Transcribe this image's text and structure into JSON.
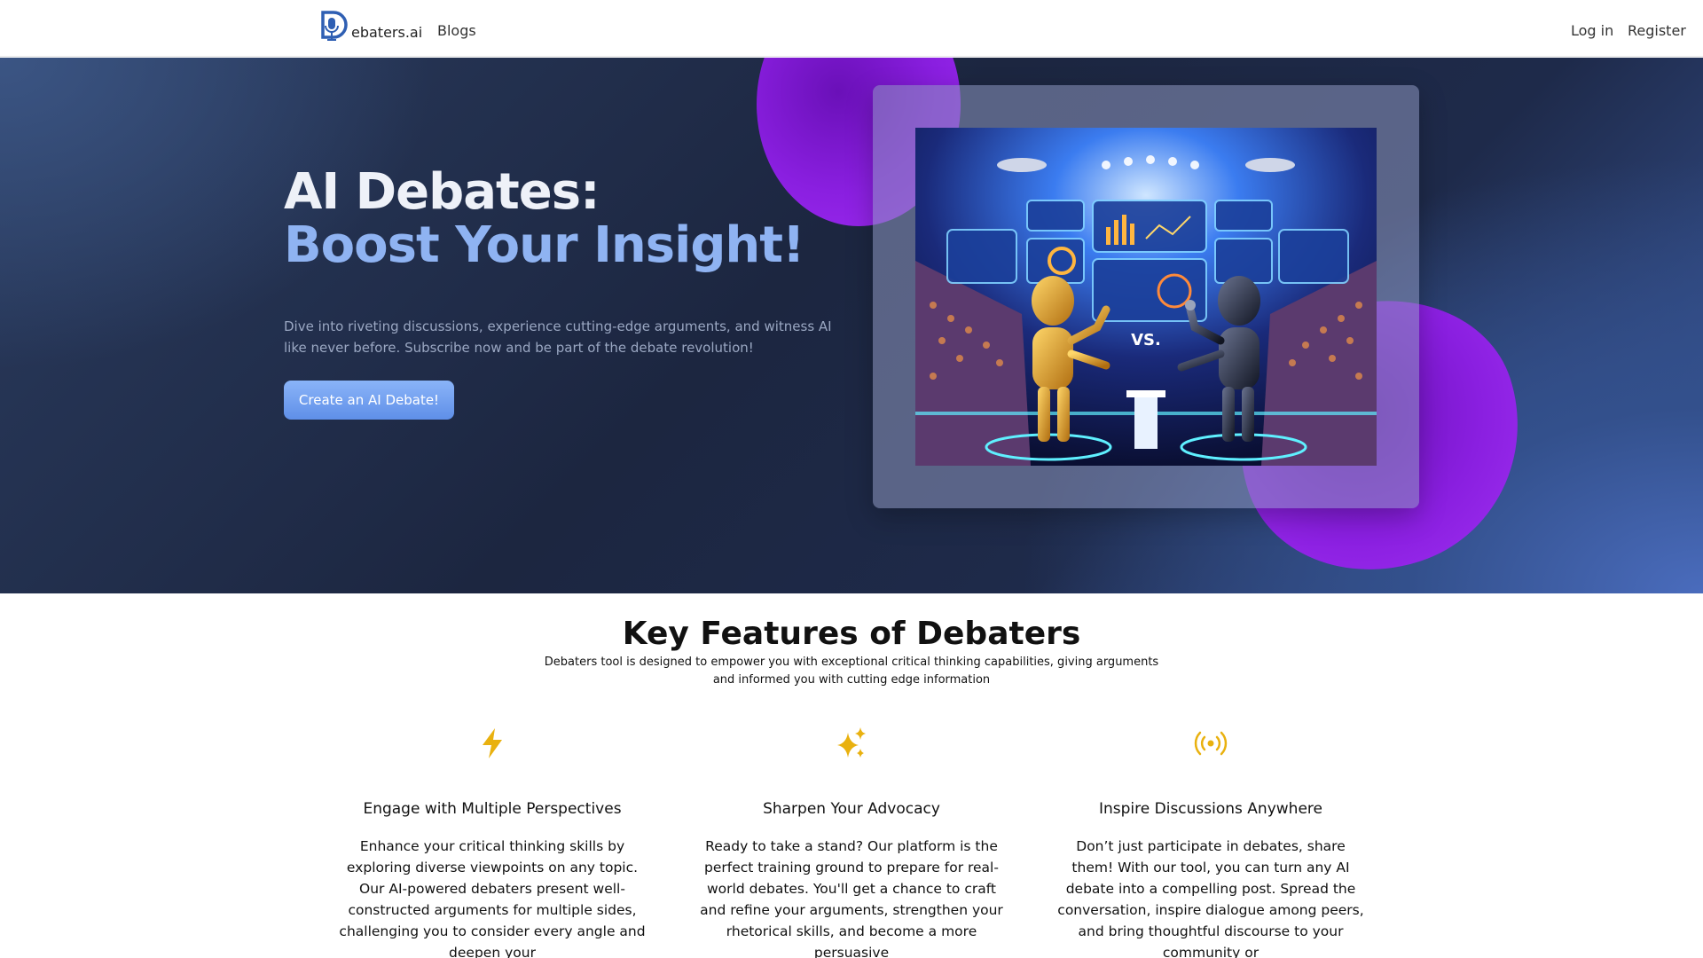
{
  "nav": {
    "logo_text": "ebaters.ai",
    "blogs": "Blogs",
    "login": "Log in",
    "register": "Register"
  },
  "hero": {
    "title_line1": "AI Debates:",
    "title_line2": "Boost Your Insight!",
    "description": "Dive into riveting discussions, experience cutting-edge arguments, and witness AI like never before. Subscribe now and be part of the debate revolution!",
    "cta": "Create an AI Debate!",
    "image_label": "VS."
  },
  "features": {
    "title": "Key Features of Debaters",
    "subtitle": "Debaters tool is designed to empower you with exceptional critical thinking capabilities, giving arguments and informed you with cutting edge information",
    "items": [
      {
        "icon": "lightning-icon",
        "title": "Engage with Multiple Perspectives",
        "text": "Enhance your critical thinking skills by exploring diverse viewpoints on any topic. Our AI-powered debaters present well-constructed arguments for multiple sides, challenging you to consider every angle and deepen your"
      },
      {
        "icon": "sparkles-icon",
        "title": "Sharpen Your Advocacy",
        "text": "Ready to take a stand? Our platform is the perfect training ground to prepare for real-world debates. You'll get a chance to craft and refine your arguments, strengthen your rhetorical skills, and become a more persuasive"
      },
      {
        "icon": "broadcast-icon",
        "title": "Inspire Discussions Anywhere",
        "text": "Don’t just participate in debates, share them! With our tool, you can turn any AI debate into a compelling post. Spread the conversation, inspire dialogue among peers, and bring thoughtful discourse to your community or"
      }
    ]
  },
  "colors": {
    "accent_icon": "#e9b10f",
    "title_highlight": "#8fb3f2",
    "button": "#6f9ef0",
    "blob": "#8a1fe0"
  }
}
